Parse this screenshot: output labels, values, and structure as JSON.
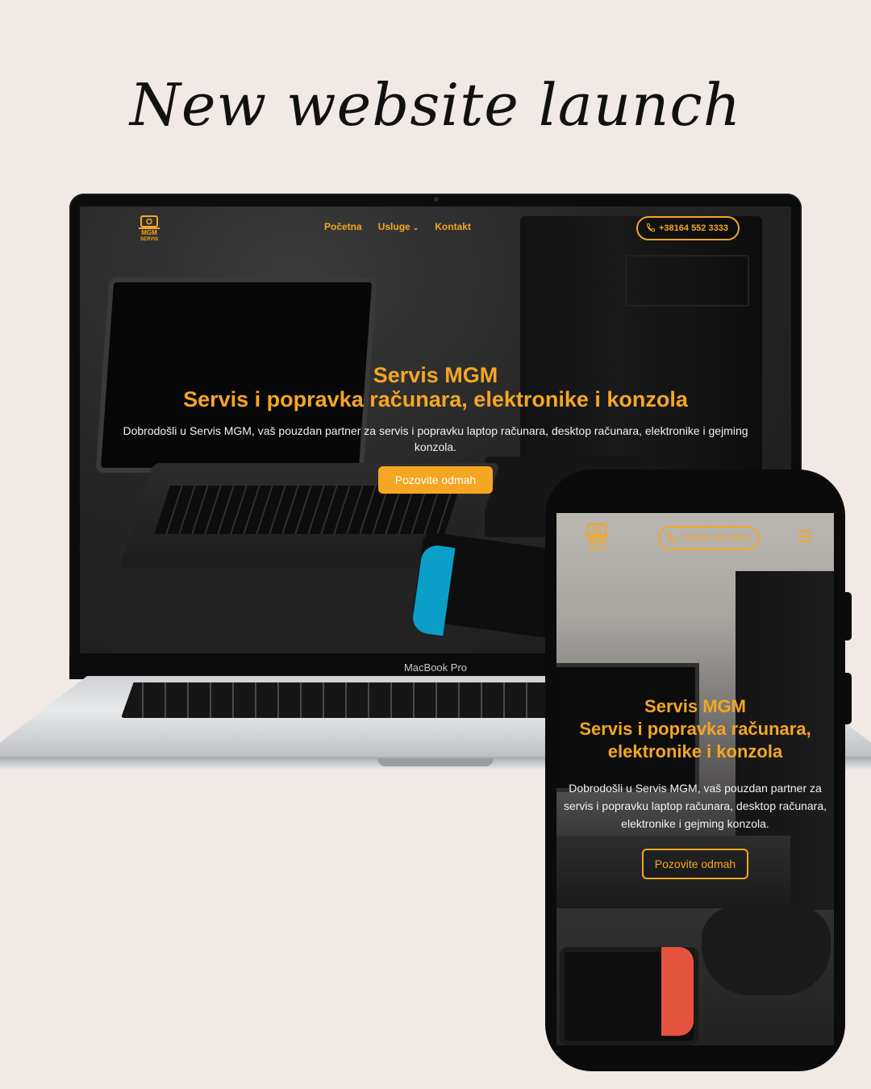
{
  "headline": "New website launch",
  "laptop": {
    "model_label": "MacBook Pro",
    "site": {
      "logo_text": "MGM SERVIS",
      "nav": [
        {
          "label": "Početna"
        },
        {
          "label": "Usluge"
        },
        {
          "label": "Kontakt"
        }
      ],
      "phone": "+38164 552 3333",
      "hero": {
        "title_line1": "Servis MGM",
        "title_line2": "Servis i popravka računara, elektronike i konzola",
        "description": "Dobrodošli u Servis MGM, vaš pouzdan partner za servis i popravku laptop računara, desktop računara, elektronike i gejming konzola.",
        "cta": "Pozovite odmah"
      }
    }
  },
  "phone": {
    "site": {
      "logo_text": "MGM SERVIS",
      "phone": "+38164 552 3333",
      "hero": {
        "title_line1": "Servis MGM",
        "title_line2": "Servis i popravka računara,",
        "title_line3": "elektronike i konzola",
        "description": "Dobrodošli u Servis MGM, vaš pouzdan partner za servis i popravku laptop računara, desktop računara, elektronike i gejming konzola.",
        "cta": "Pozovite odmah"
      }
    }
  },
  "colors": {
    "accent": "#f5a623",
    "background": "#f1e9e5"
  }
}
